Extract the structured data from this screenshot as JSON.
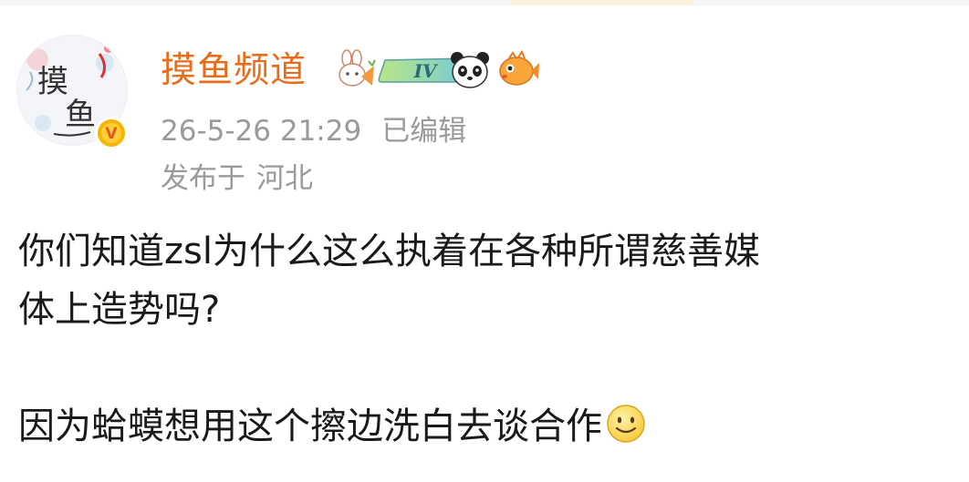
{
  "post": {
    "author": {
      "name": "摸鱼频道",
      "avatar_text": "摸鱼",
      "verified_badge_text": "V",
      "level_badge_text": "IV",
      "badge_icons": [
        "bunny-carrot-icon",
        "level-iv-badge-icon",
        "panda-icon",
        "pufferfish-icon"
      ]
    },
    "time": "26-5-26 21:29",
    "edited_label": "已编辑",
    "location_prefix": "发布于",
    "location": "河北",
    "body": {
      "line1": "你们知道zsl为什么这么执着在各种所谓慈善媒",
      "line2": "体上造势吗?",
      "line3": "因为蛤蟆想用这个擦边洗白去谈合作",
      "trailing_emoji": "smile-emoji-icon"
    }
  },
  "colors": {
    "author_name": "#ea6c1a",
    "meta_text": "#9a9a9a",
    "body_text": "#1a1a1a",
    "verified_badge": "#f7b500"
  }
}
